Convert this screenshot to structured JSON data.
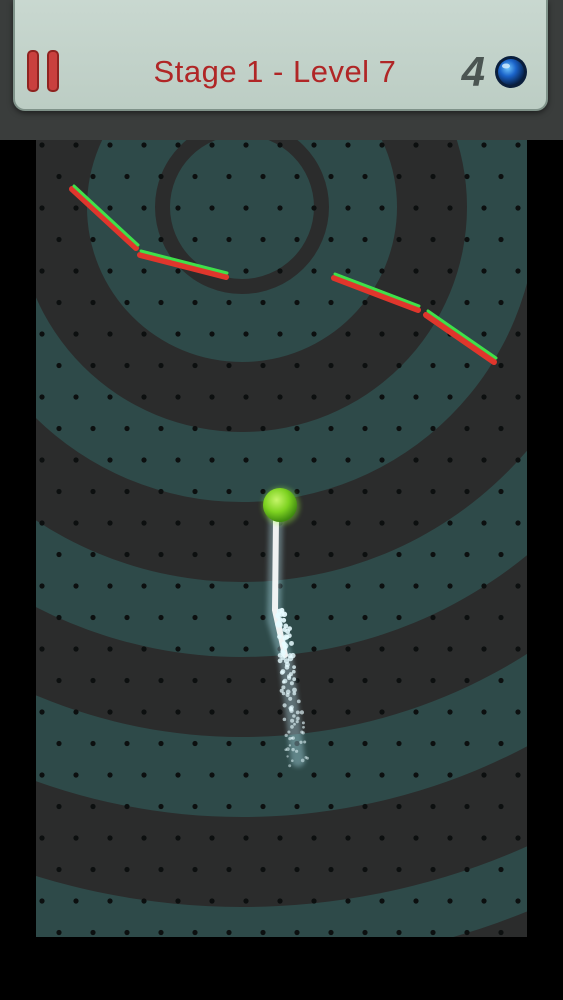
{
  "hud": {
    "level_title": "Stage 1 - Level 7",
    "balls_remaining": "4",
    "pause_icon": "pause-icon",
    "ball_icon": "ball-icon"
  },
  "colors": {
    "hud_background": "#c4d4cb",
    "title_red": "#b02626",
    "pause_red": "#c9403e",
    "ring_teal": "#2e4a49",
    "ring_dark": "#2b2c2c",
    "bar_green": "#3fe04a",
    "bar_red": "#e0362c",
    "ball_green": "#7ed321",
    "trail_white": "#e6fbff"
  },
  "board": {
    "pegs": "dot-grid",
    "obstacles": [
      "bar-1",
      "bar-2",
      "bar-3",
      "bar-4"
    ],
    "ball": "green-ball"
  }
}
